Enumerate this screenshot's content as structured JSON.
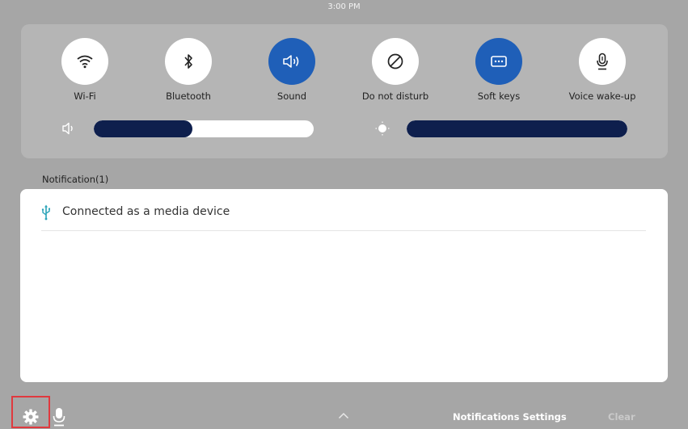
{
  "status_bar": {
    "time": "3:00 PM"
  },
  "quick_settings": {
    "toggles": [
      {
        "label": "Wi-Fi",
        "icon": "wifi-icon",
        "on": false
      },
      {
        "label": "Bluetooth",
        "icon": "bluetooth-icon",
        "on": false
      },
      {
        "label": "Sound",
        "icon": "sound-icon",
        "on": true
      },
      {
        "label": "Do not disturb",
        "icon": "do-not-disturb-icon",
        "on": false
      },
      {
        "label": "Soft keys",
        "icon": "soft-keys-icon",
        "on": true
      },
      {
        "label": "Voice wake-up",
        "icon": "microphone-icon",
        "on": false
      }
    ],
    "volume": {
      "icon": "volume-icon",
      "level": 0.45
    },
    "brightness": {
      "icon": "brightness-icon",
      "level": 1.0
    }
  },
  "notifications": {
    "header": "Notification(1)",
    "items": [
      {
        "icon": "usb-icon",
        "text": "Connected as a media device"
      }
    ]
  },
  "bottom_bar": {
    "settings_icon": "gear-icon",
    "voice_icon": "microphone-icon",
    "expand_icon": "chevron-up-icon",
    "notifications_settings_label": "Notifications Settings",
    "clear_label": "Clear"
  },
  "colors": {
    "background": "#a6a6a6",
    "panel": "#b5b5b5",
    "accent": "#1f5fb8",
    "slider_fill": "#0e1f4d",
    "usb_icon": "#2aa3b8",
    "highlight_border": "#e0393e"
  }
}
